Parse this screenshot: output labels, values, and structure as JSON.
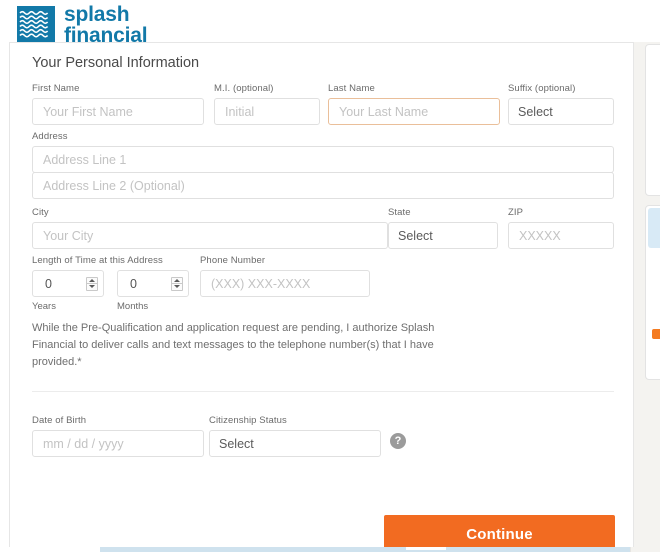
{
  "brand": {
    "logo_line1": "splash",
    "logo_line2": "financial",
    "logo_color": "#1279a8",
    "accent_color": "#f26b21"
  },
  "form": {
    "section_title": "Your Personal Information",
    "first_name": {
      "label": "First Name",
      "placeholder": "Your First Name",
      "value": ""
    },
    "middle_initial": {
      "label": "M.I. (optional)",
      "placeholder": "Initial",
      "value": ""
    },
    "last_name": {
      "label": "Last Name",
      "placeholder": "Your Last Name",
      "value": ""
    },
    "suffix": {
      "label": "Suffix (optional)",
      "selected": "Select"
    },
    "address": {
      "label": "Address",
      "line1_placeholder": "Address Line 1",
      "line1_value": "",
      "line2_placeholder": "Address Line 2 (Optional)",
      "line2_value": ""
    },
    "city": {
      "label": "City",
      "placeholder": "Your City",
      "value": ""
    },
    "state": {
      "label": "State",
      "selected": "Select"
    },
    "zip": {
      "label": "ZIP",
      "placeholder": "XXXXX",
      "value": ""
    },
    "length_of_time": {
      "label": "Length of Time at this Address",
      "years_value": "0",
      "years_label": "Years",
      "months_value": "0",
      "months_label": "Months"
    },
    "phone": {
      "label": "Phone Number",
      "placeholder": "(XXX) XXX-XXXX",
      "value": ""
    },
    "consent_text": "While the Pre-Qualification and application request are pending, I authorize Splash Financial to deliver calls and text messages to the telephone number(s) that I have provided.*",
    "date_of_birth": {
      "label": "Date of Birth",
      "placeholder": "mm / dd / yyyy",
      "value": ""
    },
    "citizenship_status": {
      "label": "Citizenship Status",
      "selected": "Select"
    },
    "help_icon_glyph": "?"
  },
  "actions": {
    "continue_label": "Continue"
  }
}
